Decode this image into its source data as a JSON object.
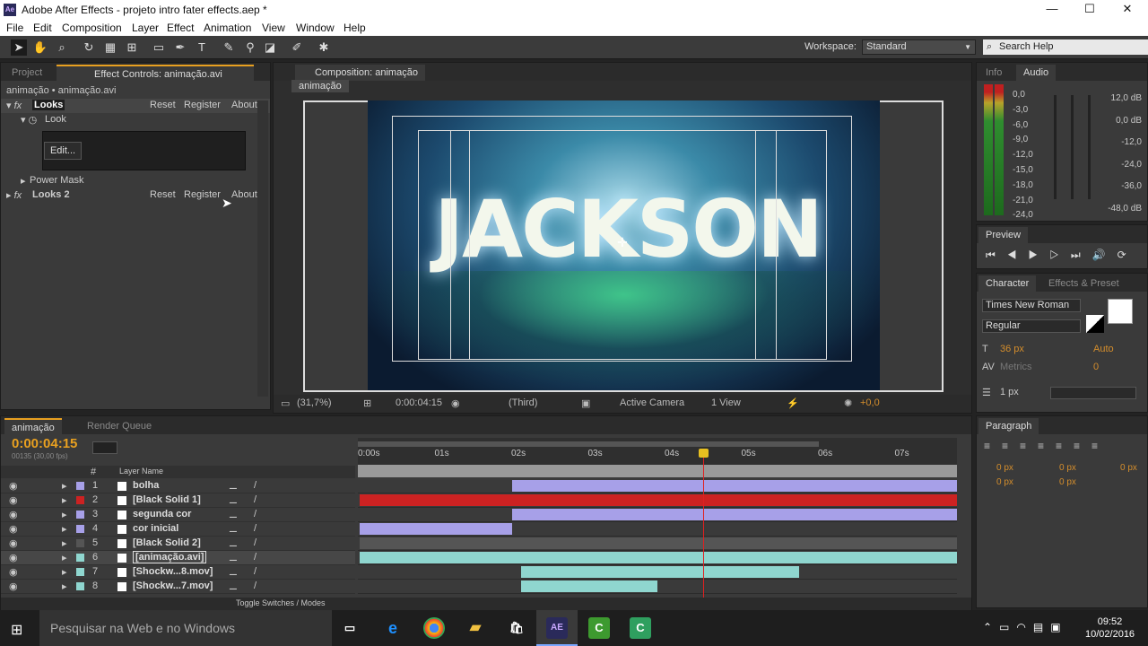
{
  "app": {
    "title": "Adobe After Effects - projeto intro fater effects.aep *",
    "logo": "Ae"
  },
  "menu": [
    "File",
    "Edit",
    "Composition",
    "Layer",
    "Effect",
    "Animation",
    "View",
    "Window",
    "Help"
  ],
  "toolbar": {
    "workspace_label": "Workspace:",
    "workspace_value": "Standard",
    "search_placeholder": "Search Help"
  },
  "left_panel": {
    "tabs": [
      "Project",
      "Effect Controls: animação.avi"
    ],
    "breadcrumb": "animação • animação.avi",
    "effects": [
      {
        "name": "Looks",
        "reset": "Reset",
        "register": "Register",
        "about": "About"
      },
      {
        "name": "Looks 2",
        "reset": "Reset",
        "register": "Register",
        "about": "About"
      }
    ],
    "look": "Look",
    "edit_button": "Edit...",
    "power_mask": "Power Mask"
  },
  "composition": {
    "tab": "Composition: animação",
    "crumb": "animação",
    "title_text": "JACKSON",
    "footer": {
      "zoom": "(31,7%)",
      "timecode": "0:00:04:15",
      "resolution": "(Third)",
      "camera": "Active Camera",
      "view": "1 View",
      "exposure": "+0,0"
    }
  },
  "right_panel": {
    "tabs": [
      "Info",
      "Audio"
    ],
    "audio_left": [
      "0,0",
      "-3,0",
      "-6,0",
      "-9,0",
      "-12,0",
      "-15,0",
      "-18,0",
      "-21,0",
      "-24,0"
    ],
    "audio_right": [
      "12,0 dB",
      "0,0 dB",
      "-12,0",
      "-24,0",
      "-36,0",
      "-48,0 dB"
    ],
    "preview_tab": "Preview",
    "character_tabs": [
      "Character",
      "Effects & Preset"
    ],
    "font": "Times New Roman",
    "style": "Regular",
    "size": "36 px",
    "leading": "Auto",
    "tracking": "Metrics",
    "kerning": "0",
    "stroke": "1 px",
    "paragraph_tab": "Paragraph",
    "indents": [
      "0 px",
      "0 px",
      "0 px",
      "0 px",
      "0 px"
    ]
  },
  "timeline": {
    "tabs": [
      "animação",
      "Render Queue"
    ],
    "timecode": "0:00:04:15",
    "fps": "00135 (30,00 fps)",
    "col_num": "#",
    "col_name": "Layer Name",
    "ruler": [
      "0:00s",
      "01s",
      "02s",
      "03s",
      "04s",
      "05s",
      "06s",
      "07s"
    ],
    "layers": [
      {
        "n": "1",
        "name": "bolha",
        "color": "#a7a0e8"
      },
      {
        "n": "2",
        "name": "[Black Solid 1]",
        "color": "#cc2222"
      },
      {
        "n": "3",
        "name": "segunda cor",
        "color": "#a7a0e8"
      },
      {
        "n": "4",
        "name": "cor inicial",
        "color": "#a7a0e8"
      },
      {
        "n": "5",
        "name": "[Black Solid 2]",
        "color": "#555555"
      },
      {
        "n": "6",
        "name": "[animação.avi]",
        "color": "#8fd6cf"
      },
      {
        "n": "7",
        "name": "[Shockw...8.mov]",
        "color": "#8fd6cf"
      },
      {
        "n": "8",
        "name": "[Shockw...7.mov]",
        "color": "#8fd6cf"
      }
    ],
    "toggle": "Toggle Switches / Modes"
  },
  "taskbar": {
    "search": "Pesquisar na Web e no Windows",
    "time": "09:52",
    "date": "10/02/2016"
  }
}
